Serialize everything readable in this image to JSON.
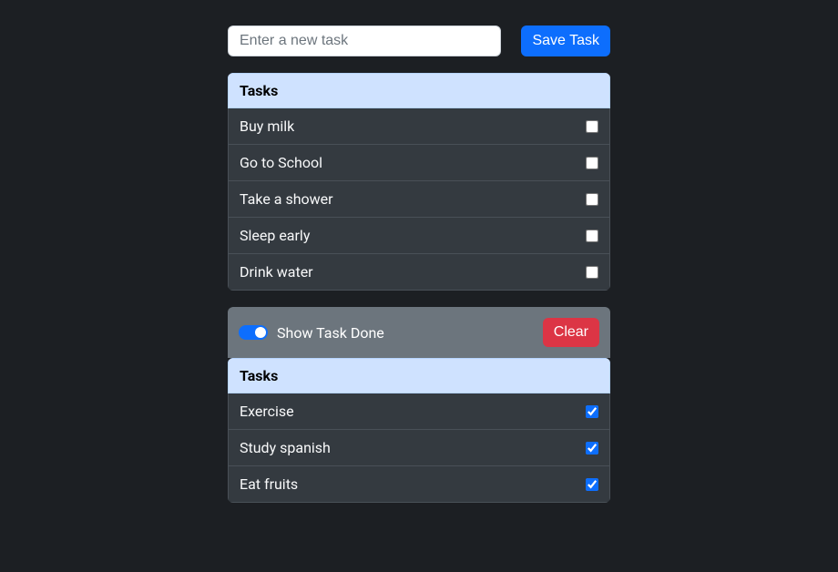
{
  "input": {
    "placeholder": "Enter a new task",
    "save_label": "Save Task"
  },
  "pending": {
    "header": "Tasks",
    "items": [
      {
        "label": "Buy milk",
        "checked": false
      },
      {
        "label": "Go to School",
        "checked": false
      },
      {
        "label": "Take a shower",
        "checked": false
      },
      {
        "label": "Sleep early",
        "checked": false
      },
      {
        "label": "Drink water",
        "checked": false
      }
    ]
  },
  "done_bar": {
    "toggle_label": "Show Task Done",
    "toggle_on": true,
    "clear_label": "Clear"
  },
  "done": {
    "header": "Tasks",
    "items": [
      {
        "label": "Exercise",
        "checked": true
      },
      {
        "label": "Study spanish",
        "checked": true
      },
      {
        "label": "Eat fruits",
        "checked": true
      }
    ]
  }
}
